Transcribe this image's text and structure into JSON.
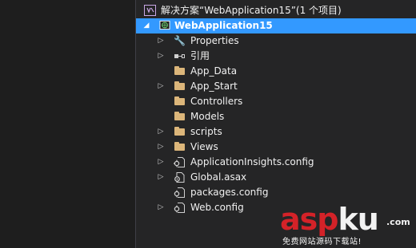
{
  "solution_explorer": {
    "solution_label": "解决方案“WebApplication15”(1 个项目)",
    "project_label": "WebApplication15",
    "items": [
      {
        "label": "Properties",
        "icon": "wrench-icon"
      },
      {
        "label": "引用",
        "icon": "references-icon"
      },
      {
        "label": "App_Data",
        "icon": "folder-icon"
      },
      {
        "label": "App_Start",
        "icon": "folder-icon"
      },
      {
        "label": "Controllers",
        "icon": "folder-icon"
      },
      {
        "label": "Models",
        "icon": "folder-icon"
      },
      {
        "label": "scripts",
        "icon": "folder-icon"
      },
      {
        "label": "Views",
        "icon": "folder-icon"
      },
      {
        "label": "ApplicationInsights.config",
        "icon": "config-file-icon"
      },
      {
        "label": "Global.asax",
        "icon": "asax-file-icon"
      },
      {
        "label": "packages.config",
        "icon": "config-file-icon"
      },
      {
        "label": "Web.config",
        "icon": "config-file-icon"
      }
    ]
  },
  "watermark": {
    "logo_asp": "asp",
    "logo_ku": "ku",
    "logo_com": ".com",
    "tagline": "免费网站源码下载站!"
  },
  "colors": {
    "background": "#252526",
    "selection": "#3399ff",
    "folder": "#dcb67a",
    "brand_red": "#d42228"
  }
}
